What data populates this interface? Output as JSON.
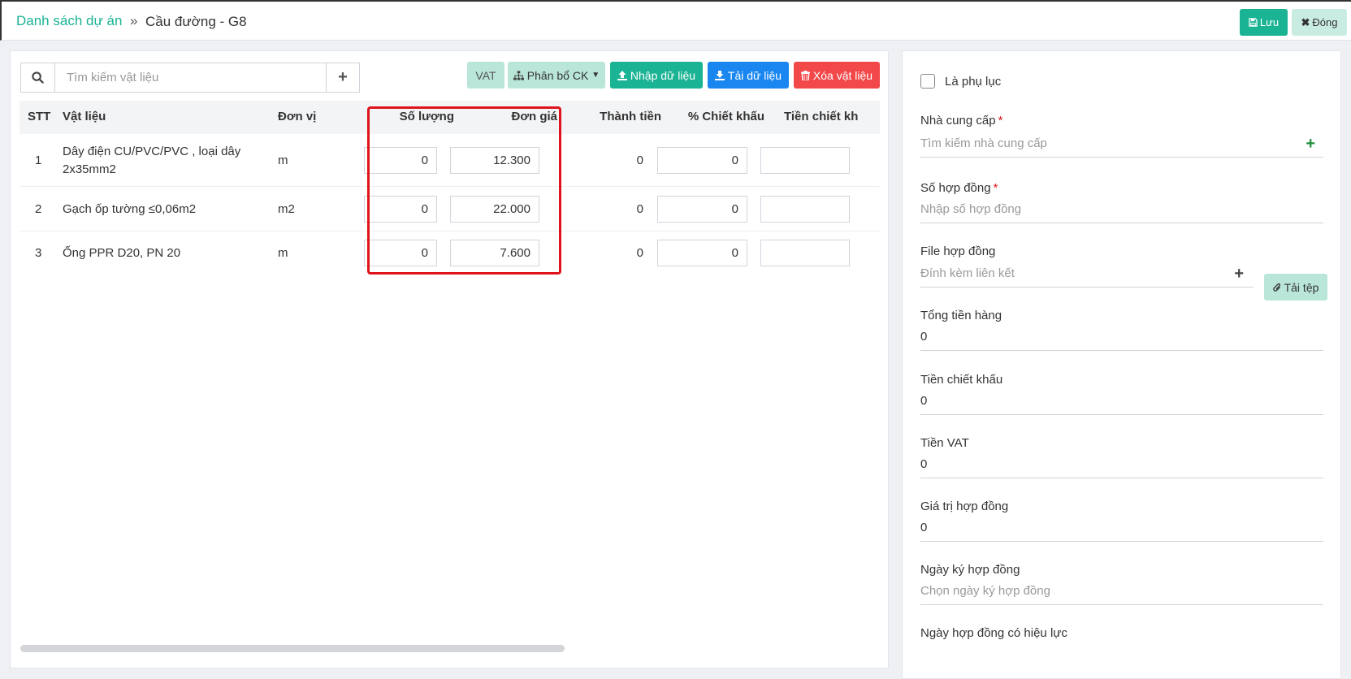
{
  "header": {
    "breadcrumb_link": "Danh sách dự án",
    "breadcrumb_sep": "»",
    "breadcrumb_current": "Cầu đường - G8",
    "save_label": "Lưu",
    "close_label": "Đóng"
  },
  "toolbar": {
    "search_placeholder": "Tìm kiếm vật liệu",
    "add_label": "+",
    "vat_label": "VAT",
    "phanbo_label": "Phân bổ CK",
    "nhap_label": "Nhập dữ liệu",
    "tai_label": "Tải dữ liệu",
    "xoa_label": "Xóa vật liệu"
  },
  "table": {
    "headers": {
      "stt": "STT",
      "vatlieu": "Vật liệu",
      "donvi": "Đơn vị",
      "soluong": "Số lượng",
      "dongia": "Đơn giá",
      "thanhtien": "Thành tiền",
      "chietkhau": "% Chiết khấu",
      "tienchietkhau": "Tiền chiết kh"
    },
    "rows": [
      {
        "stt": "1",
        "name_line1": "Dây điện CU/PVC/PVC , loại dây",
        "name_line2": "2x35mm2",
        "unit": "m",
        "qty": "0",
        "price": "12.300",
        "total": "0",
        "discount": "0"
      },
      {
        "stt": "2",
        "name_line1": "Gạch ốp tường ≤0,06m2",
        "name_line2": "",
        "unit": "m2",
        "qty": "0",
        "price": "22.000",
        "total": "0",
        "discount": "0"
      },
      {
        "stt": "3",
        "name_line1": "Ống PPR D20, PN 20",
        "name_line2": "",
        "unit": "m",
        "qty": "0",
        "price": "7.600",
        "total": "0",
        "discount": "0"
      }
    ]
  },
  "form": {
    "phuluc_label": "Là phụ lục",
    "supplier_label": "Nhà cung cấp",
    "supplier_placeholder": "Tìm kiếm nhà cung cấp",
    "contract_no_label": "Số hợp đồng",
    "contract_no_placeholder": "Nhập số hợp đồng",
    "file_label": "File hợp đồng",
    "file_placeholder": "Đính kèm liên kết",
    "upload_label": "Tải tệp",
    "total_goods_label": "Tổng tiền hàng",
    "total_goods_value": "0",
    "discount_label": "Tiền chiết khấu",
    "discount_value": "0",
    "vat_label": "Tiền VAT",
    "vat_value": "0",
    "contract_value_label": "Giá trị hợp đồng",
    "contract_value_value": "0",
    "sign_date_label": "Ngày ký hợp đồng",
    "sign_date_placeholder": "Chọn ngày ký hợp đồng",
    "effective_date_label": "Ngày hợp đồng có hiệu lực",
    "required_mark": "*"
  },
  "colors": {
    "primary": "#1ab394",
    "primary_light": "#b9e6d9",
    "info": "#1a87f0",
    "danger": "#f2484a",
    "highlight": "#e0131c"
  }
}
